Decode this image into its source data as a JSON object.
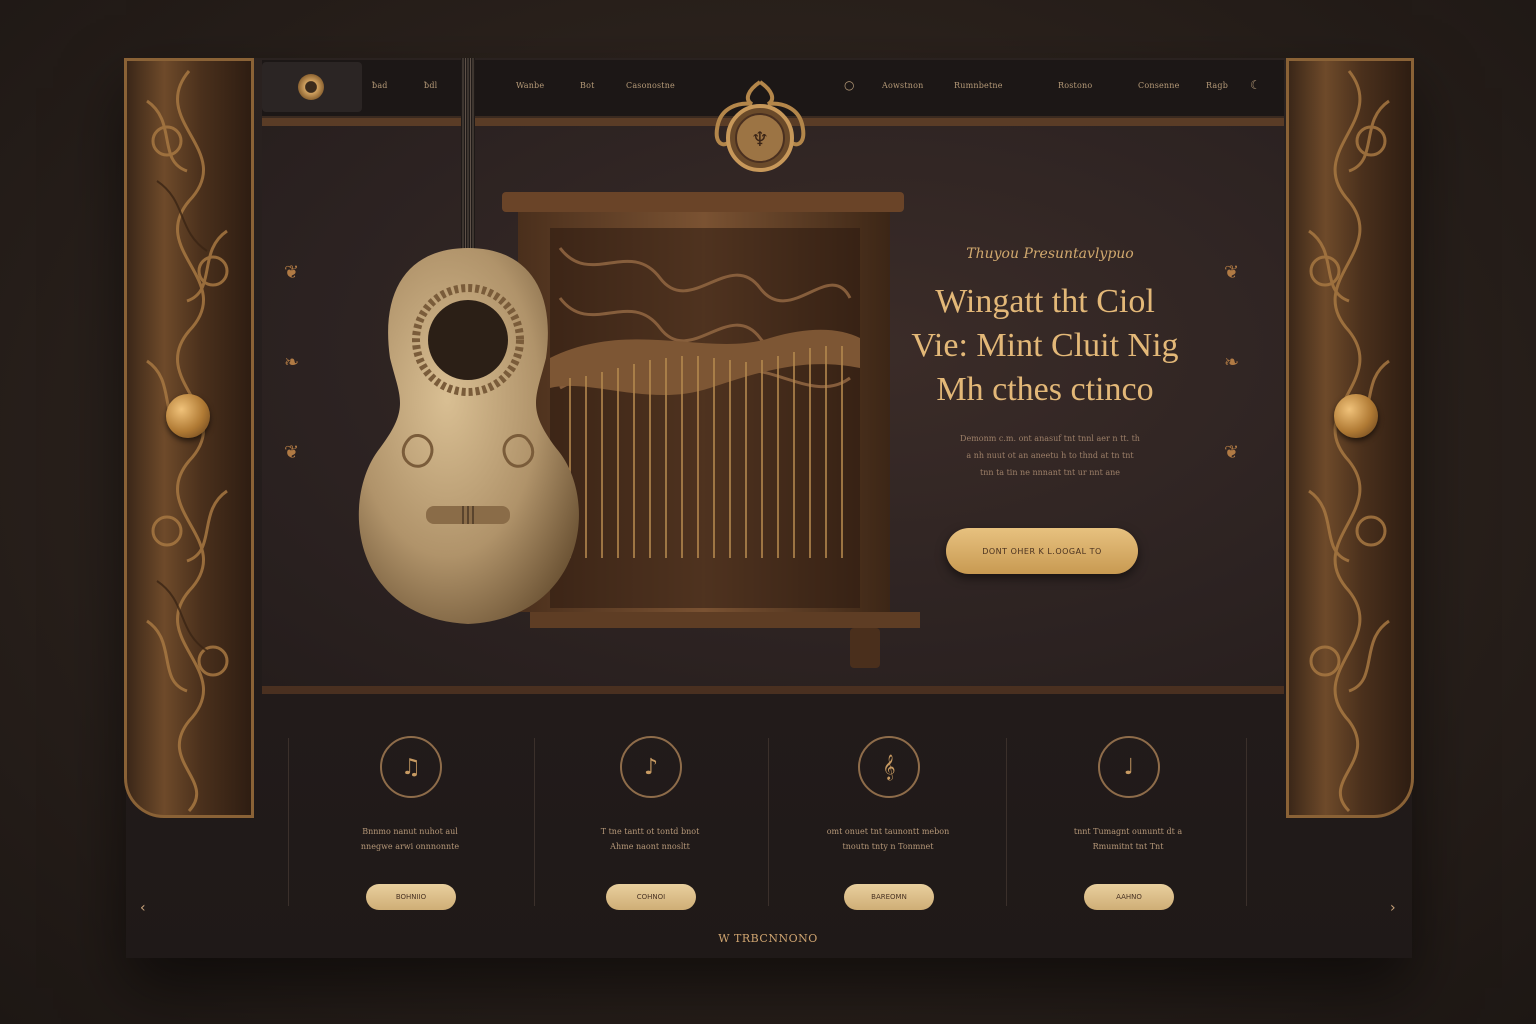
{
  "nav": {
    "links": [
      "ƀad",
      "ƀdl",
      "Wanbe",
      "Bot",
      "Casonostne",
      "Aowstnon",
      "Rumnbetne",
      "Rostono",
      "Consenne",
      "Ragb"
    ]
  },
  "hero": {
    "eyebrow": "Thuyou Presuntavlypuo",
    "headline_lines": [
      "Wingatt tht Ciol",
      "Vie: Mint Cluit Nig",
      "Mh cthes ctinco"
    ],
    "body_lines": [
      "Demonm c.m. ont anasuf tnt  tnnl aer n tt. th",
      "a nh  nuut ot an aneetu h to thnd  at tn tnt",
      "tnn ta tin ne nnnant tnt ur nnt ane"
    ],
    "cta_label": "DONT OHER K L.OOGAL TO"
  },
  "features": [
    {
      "icon": "music-box-icon",
      "glyph": "♫",
      "text_lines": [
        "Bnnmo  nanut  nuhot aul",
        "nnegwe arwi onnnonnte"
      ],
      "button": "BOHNIIO"
    },
    {
      "icon": "performer-icon",
      "glyph": "♪",
      "text_lines": [
        "T tne tantt ot tontd bnot",
        "Ahme naont nnosltt"
      ],
      "button": "COHNOI"
    },
    {
      "icon": "sheet-music-icon",
      "glyph": "𝄞",
      "text_lines": [
        "omt onuet tnt taunontt mebon",
        "tnoutn tnty n Tonmnet"
      ],
      "button": "BAREOMN"
    },
    {
      "icon": "instrument-icon",
      "glyph": "♩",
      "text_lines": [
        "tnnt Tumagnt oununtt dt a",
        "Rmumitnt tnt Tnt"
      ],
      "button": "AAHNO"
    }
  ],
  "footer": {
    "label": "W TRBCNNONO"
  },
  "colors": {
    "accent": "#e3b878",
    "button": "#d8ad68",
    "background": "#231c1b",
    "wood": "#6e4a2a"
  }
}
